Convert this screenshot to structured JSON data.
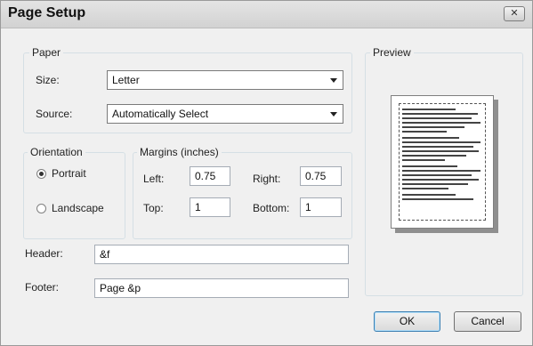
{
  "window": {
    "title": "Page Setup",
    "close_label": "✕"
  },
  "paper": {
    "legend": "Paper",
    "size_label": "Size:",
    "size_value": "Letter",
    "source_label": "Source:",
    "source_value": "Automatically Select"
  },
  "orientation": {
    "legend": "Orientation",
    "portrait_label": "Portrait",
    "landscape_label": "Landscape",
    "selected": "Portrait"
  },
  "margins": {
    "legend": "Margins (inches)",
    "left_label": "Left:",
    "left_value": "0.75",
    "right_label": "Right:",
    "right_value": "0.75",
    "top_label": "Top:",
    "top_value": "1",
    "bottom_label": "Bottom:",
    "bottom_value": "1"
  },
  "header": {
    "label": "Header:",
    "value": "&f"
  },
  "footer": {
    "label": "Footer:",
    "value": "Page &p"
  },
  "preview": {
    "legend": "Preview"
  },
  "buttons": {
    "ok": "OK",
    "cancel": "Cancel"
  }
}
